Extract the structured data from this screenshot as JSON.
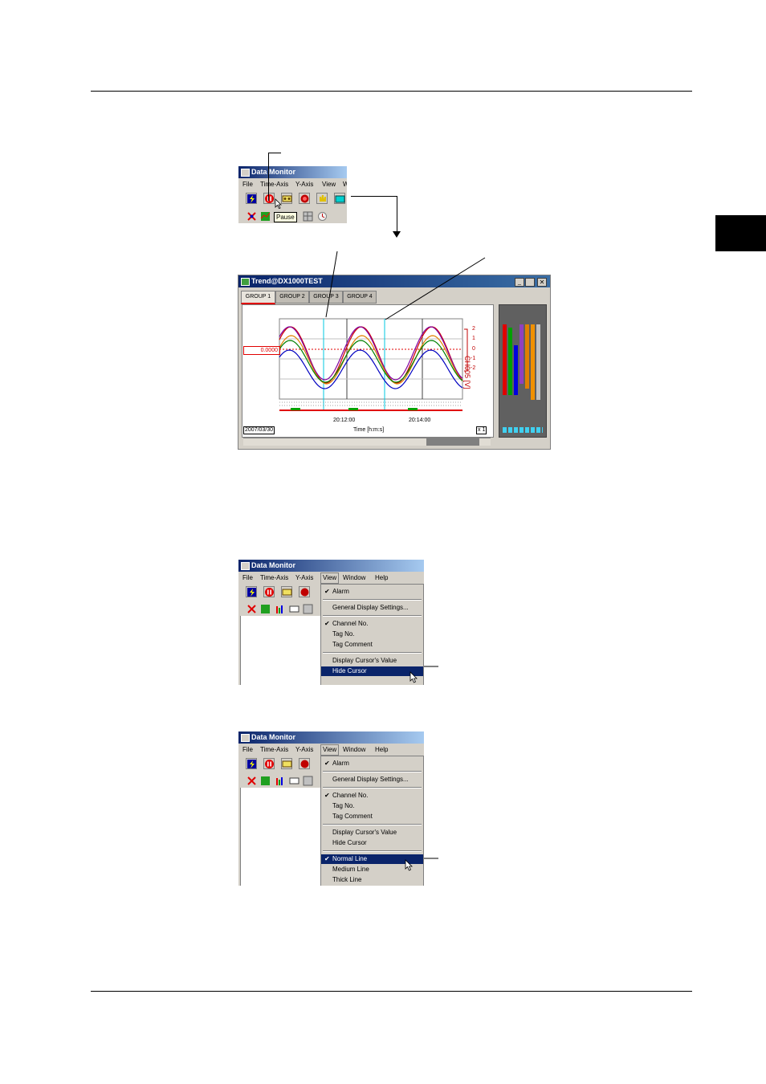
{
  "section_tab": "",
  "figure1": {
    "window_title": "Data Monitor",
    "menu": [
      "File",
      "Time-Axis",
      "Y-Axis",
      "View",
      "W"
    ],
    "tooltip": "Pause"
  },
  "figure2": {
    "window_title": "Trend@DX1000TEST",
    "tabs": [
      "GROUP 1",
      "GROUP 2",
      "GROUP 3",
      "GROUP 4"
    ],
    "cursor_value": "0.0000",
    "scale_labels": [
      "2",
      "1",
      "0",
      "-1",
      "-2"
    ],
    "channel_label": "CH005 [V]",
    "time_ticks": [
      "20:12:00",
      "20:14:00"
    ],
    "date": "2007/03/30",
    "time_axis_label": "Time [h:m:s]",
    "zoom": "x 1"
  },
  "figure3": {
    "window_title": "Data Monitor",
    "menu": [
      "File",
      "Time-Axis",
      "Y-Axis",
      "View",
      "Window",
      "Help"
    ],
    "items": [
      {
        "label": "Alarm",
        "checked": true
      },
      {
        "label": "General Display Settings...",
        "checked": false
      },
      {
        "label": "Channel No.",
        "checked": true
      },
      {
        "label": "Tag No.",
        "checked": false
      },
      {
        "label": "Tag Comment",
        "checked": false
      },
      {
        "label": "Display Cursor's Value",
        "checked": false
      },
      {
        "label": "Hide Cursor",
        "checked": false,
        "selected": true
      }
    ]
  },
  "figure4": {
    "window_title": "Data Monitor",
    "menu": [
      "File",
      "Time-Axis",
      "Y-Axis",
      "View",
      "Window",
      "Help"
    ],
    "items": [
      {
        "label": "Alarm",
        "checked": true
      },
      {
        "label": "General Display Settings...",
        "checked": false
      },
      {
        "label": "Channel No.",
        "checked": true
      },
      {
        "label": "Tag No.",
        "checked": false
      },
      {
        "label": "Tag Comment",
        "checked": false
      },
      {
        "label": "Display Cursor's Value",
        "checked": false
      },
      {
        "label": "Hide Cursor",
        "checked": false
      },
      {
        "label": "Normal Line",
        "checked": true,
        "selected": true
      },
      {
        "label": "Medium Line",
        "checked": false
      },
      {
        "label": "Thick Line",
        "checked": false
      }
    ]
  },
  "colors": {
    "titlebar": "#0a246a",
    "cursor": "#00c8e0",
    "wave_red": "#d00000",
    "wave_purple": "#8000a0",
    "wave_orange": "#e08000",
    "wave_green": "#008000",
    "wave_blue": "#0000c0"
  }
}
